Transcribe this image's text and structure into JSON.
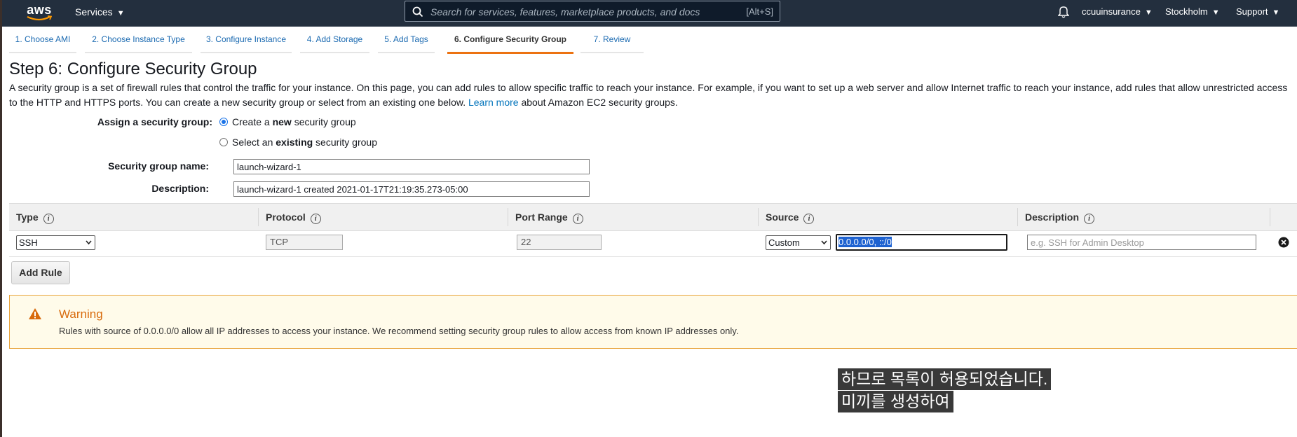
{
  "topnav": {
    "logo": "aws",
    "services": "Services",
    "search_placeholder": "Search for services, features, marketplace products, and docs",
    "search_shortcut": "[Alt+S]",
    "account": "ccuuinsurance",
    "region": "Stockholm",
    "support": "Support"
  },
  "wizard": {
    "tabs": [
      {
        "label": "1. Choose AMI"
      },
      {
        "label": "2. Choose Instance Type"
      },
      {
        "label": "3. Configure Instance"
      },
      {
        "label": "4. Add Storage"
      },
      {
        "label": "5. Add Tags"
      },
      {
        "label": "6. Configure Security Group",
        "active": true
      },
      {
        "label": "7. Review"
      }
    ]
  },
  "page": {
    "title": "Step 6: Configure Security Group",
    "intro": "A security group is a set of firewall rules that control the traffic for your instance. On this page, you can add rules to allow specific traffic to reach your instance. For example, if you want to set up a web server and allow Internet traffic to reach your instance, add rules that allow unrestricted access to the HTTP and HTTPS ports. You can create a new security group or select from an existing one below.",
    "learn_more": "Learn more",
    "intro_tail": "about Amazon EC2 security groups."
  },
  "form": {
    "assign_label": "Assign a security group:",
    "option_new_pre": "Create a ",
    "option_new_bold": "new",
    "option_new_post": " security group",
    "option_existing_pre": "Select an ",
    "option_existing_bold": "existing",
    "option_existing_post": " security group",
    "name_label": "Security group name:",
    "name_value": "launch-wizard-1",
    "desc_label": "Description:",
    "desc_value": "launch-wizard-1 created 2021-01-17T21:19:35.273-05:00"
  },
  "rules_table": {
    "headers": {
      "type": "Type",
      "protocol": "Protocol",
      "port_range": "Port Range",
      "source": "Source",
      "description": "Description"
    },
    "rows": [
      {
        "type": "SSH",
        "protocol": "TCP",
        "port_range": "22",
        "source_mode": "Custom",
        "source_value": "0.0.0.0/0, ::/0",
        "description_placeholder": "e.g. SSH for Admin Desktop"
      }
    ],
    "add_rule": "Add Rule"
  },
  "warning": {
    "title": "Warning",
    "body": "Rules with source of 0.0.0.0/0 allow all IP addresses to access your instance. We recommend setting security group rules to allow access from known IP addresses only."
  },
  "subtitles": {
    "line1": "하므로 목록이 허용되었습니다.",
    "line2": "미끼를 생성하여"
  },
  "colors": {
    "nav_bg": "#232f3e",
    "accent_orange": "#ec7211",
    "link_blue": "#1b6ab1",
    "warning_bg": "#fffbea",
    "warning_border": "#e8a33a"
  }
}
